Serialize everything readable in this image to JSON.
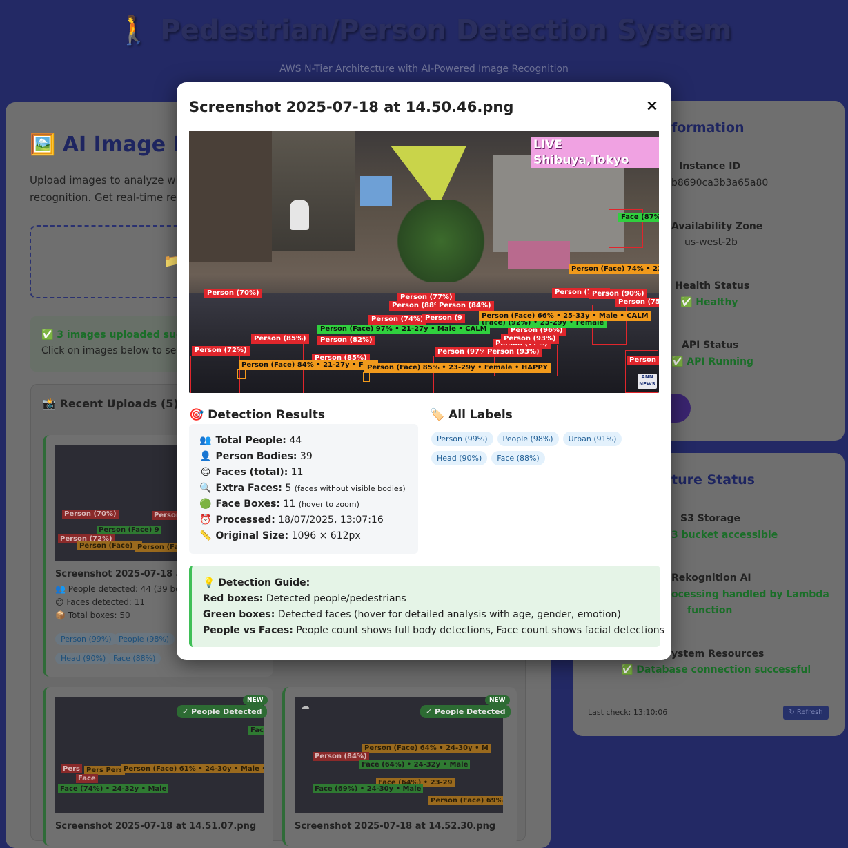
{
  "app": {
    "title": "🚶 Pedestrian/Person Detection System",
    "subtitle": "AWS N-Tier Architecture with AI-Powered Image Recognition"
  },
  "background": {
    "section_title": "🖼️ AI Image R",
    "intro_line1": "Upload images to analyze with",
    "intro_line2": "recognition. Get real-time resu",
    "upload_success": "✅ 3 images uploaded succ",
    "upload_hint": "Click on images below to see d",
    "recent_title": "📸 Recent Uploads (5)",
    "card1": {
      "filename": "Screenshot 2025-07-18 at 1",
      "people": "👥 People detected: 44 (39 bod",
      "faces": "😊 Faces detected: 11",
      "boxes": "📦 Total boxes: 50",
      "tags": [
        "Person (99%)",
        "People (98%)",
        "Head (90%)",
        "Face (88%)"
      ]
    },
    "card3": {
      "filename": "Screenshot 2025-07-18 at 14.51.07.png",
      "badge": "✓ People Detected",
      "new": "NEW"
    },
    "card4": {
      "filename": "Screenshot 2025-07-18 at 14.52.30.png",
      "badge": "✓ People Detected",
      "new": "NEW"
    },
    "info_title": "formation",
    "instance_label": "Instance ID",
    "instance_value": "b8690ca3b3a65a80",
    "az_label": "Availability Zone",
    "az_value": "us-west-2b",
    "health_label": "Health Status",
    "health_value": "✅ Healthy",
    "api_label": "API Status",
    "api_value": "✅ API Running",
    "infra_title": "ture Status",
    "s3_label": "S3 Storage",
    "s3_value": "3 bucket accessible",
    "rek_label": "Rekognition AI",
    "rek_value1": "ocessing handled by Lambda",
    "rek_value2": "function",
    "sys_label": "ystem Resources",
    "sys_value": "✅ Database connection successful",
    "last_check": "Last check: 13:10:06",
    "refresh": "↻ Refresh"
  },
  "modal": {
    "title": "Screenshot 2025-07-18 at 14.50.46.png",
    "close": "×",
    "image_overlay_text": "LIVE Shibuya,Tokyo",
    "broadcaster_logo": "ANN NEWS",
    "boxes": [
      "Person (70%)",
      "Person (72%)",
      "Person (85%)",
      "Person (82%)",
      "Person (85%)",
      "Person (77%)",
      "Person (88%)",
      "Person (84%)",
      "Person (74%)",
      "Person (9",
      "Person (97%)",
      "Person (93%)",
      "Person (77%)",
      "Person (96%)",
      "Person (93%)",
      "Person (73%)",
      "Person (90%)",
      "Person (75%)",
      "Person (",
      "Face (87%",
      "Person (Face) 74% • 23-",
      "Person (Face) 66% • 25-33y • Male • CALM",
      "Person (Face) 97% • 21-27y • Male • CALM",
      "Person (Face) 84% • 21-27y • Fem",
      "Person (Face) 85% • 23-29y • Female • HAPPY",
      "(Face) (92%) • 23-29y • Female"
    ],
    "results_title": "🎯 Detection Results",
    "results": [
      {
        "icon": "👥",
        "label": "Total People:",
        "value": "44",
        "note": ""
      },
      {
        "icon": "👤",
        "label": "Person Bodies:",
        "value": "39",
        "note": ""
      },
      {
        "icon": "😊",
        "label": "Faces (total):",
        "value": "11",
        "note": ""
      },
      {
        "icon": "🔍",
        "label": "Extra Faces:",
        "value": "5",
        "note": "(faces without visible bodies)"
      },
      {
        "icon": "🟢",
        "label": "Face Boxes:",
        "value": "11",
        "note": "(hover to zoom)"
      },
      {
        "icon": "⏰",
        "label": "Processed:",
        "value": "18/07/2025, 13:07:16",
        "note": ""
      },
      {
        "icon": "📏",
        "label": "Original Size:",
        "value": "1096 × 612px",
        "note": ""
      }
    ],
    "labels_title": "🏷️ All Labels",
    "labels": [
      "Person (99%)",
      "People (98%)",
      "Urban (91%)",
      "Head (90%)",
      "Face (88%)"
    ],
    "guide": {
      "title": "💡 Detection Guide:",
      "red_label": "Red boxes:",
      "red_text": "Detected people/pedestrians",
      "green_label": "Green boxes:",
      "green_text": "Detected faces (hover for detailed analysis with age, gender, emotion)",
      "pvf_label": "People vs Faces:",
      "pvf_text": "People count shows full body detections, Face count shows facial detections"
    }
  }
}
